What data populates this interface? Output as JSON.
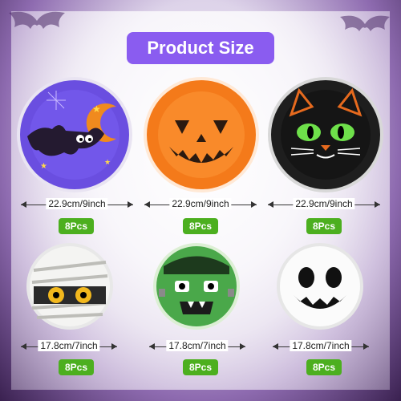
{
  "title": "Product Size",
  "colors": {
    "title_bg": "#8a5cf0",
    "badge_bg": "#4caf1f"
  },
  "plates": [
    {
      "name": "bat-plate",
      "size": "22.9cm/9inch",
      "qty": "8Pcs"
    },
    {
      "name": "pumpkin-plate",
      "size": "22.9cm/9inch",
      "qty": "8Pcs"
    },
    {
      "name": "cat-plate",
      "size": "22.9cm/9inch",
      "qty": "8Pcs"
    },
    {
      "name": "mummy-plate",
      "size": "17.8cm/7inch",
      "qty": "8Pcs"
    },
    {
      "name": "frankenstein-plate",
      "size": "17.8cm/7inch",
      "qty": "8Pcs"
    },
    {
      "name": "ghost-plate",
      "size": "17.8cm/7inch",
      "qty": "8Pcs"
    }
  ]
}
